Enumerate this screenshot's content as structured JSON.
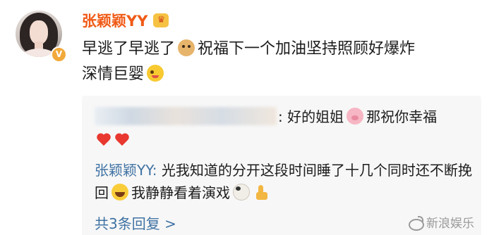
{
  "post": {
    "author": "张颖颖YY",
    "verified_badge": "V",
    "crown_icon": "crown-icon",
    "comment_part1": "早逃了早逃了",
    "comment_part2": "祝福下一个加油坚持照顾好爆炸",
    "comment_part3": "深情巨婴"
  },
  "replies": [
    {
      "author_hidden": true,
      "text_part1": "好的姐姐",
      "text_part2": "那祝你幸福"
    },
    {
      "author": "张颖颖YY",
      "colon": ":",
      "text_part1": " 光我知道的分开这段时间睡了十几个同时还不断挽回",
      "text_part2": "我静静看着演戏"
    }
  ],
  "more_replies_label": "共3条回复 >",
  "watermark": "新浪娱乐",
  "colors": {
    "username": "#f05a16",
    "reply_name": "#3f72a3",
    "reply_bg": "#f7f7f7"
  }
}
